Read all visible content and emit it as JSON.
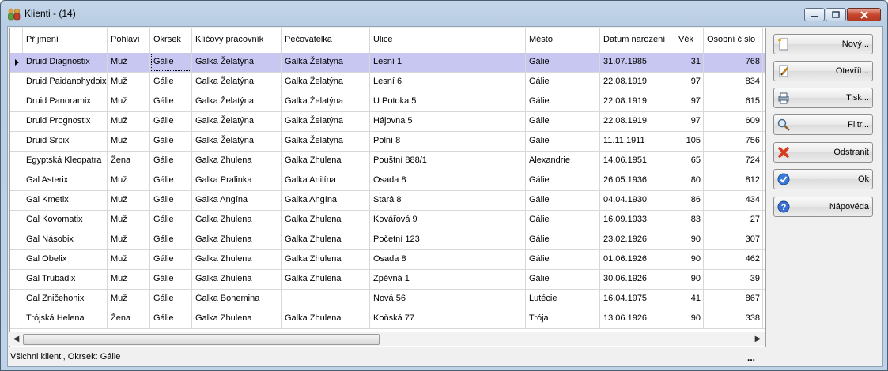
{
  "window": {
    "title": "Klienti - (14)"
  },
  "columns": [
    {
      "label": "Příjmení",
      "w": 107
    },
    {
      "label": "Pohlaví",
      "w": 54
    },
    {
      "label": "Okrsek",
      "w": 53
    },
    {
      "label": "Klíčový pracovník",
      "w": 113
    },
    {
      "label": "Pečovatelka",
      "w": 112
    },
    {
      "label": "Ulice",
      "w": 197
    },
    {
      "label": "Město",
      "w": 94
    },
    {
      "label": "Datum narození",
      "w": 95
    },
    {
      "label": "Věk",
      "w": 36
    },
    {
      "label": "Osobní číslo",
      "w": 75
    }
  ],
  "rows": [
    [
      "Druid Diagnostix",
      "Muž",
      "Gálie",
      "Galka Želatýna",
      "Galka Želatýna",
      "Lesní 1",
      "Gálie",
      "31.07.1985",
      "31",
      "768"
    ],
    [
      "Druid Paidanohydoix",
      "Muž",
      "Gálie",
      "Galka Želatýna",
      "Galka Želatýna",
      "Lesní 6",
      "Gálie",
      "22.08.1919",
      "97",
      "834"
    ],
    [
      "Druid Panoramix",
      "Muž",
      "Gálie",
      "Galka Želatýna",
      "Galka Želatýna",
      "U Potoka 5",
      "Gálie",
      "22.08.1919",
      "97",
      "615"
    ],
    [
      "Druid Prognostix",
      "Muž",
      "Gálie",
      "Galka Želatýna",
      "Galka Želatýna",
      "Hájovna 5",
      "Gálie",
      "22.08.1919",
      "97",
      "609"
    ],
    [
      "Druid Srpix",
      "Muž",
      "Gálie",
      "Galka Želatýna",
      "Galka Želatýna",
      "Polní 8",
      "Gálie",
      "11.11.1911",
      "105",
      "756"
    ],
    [
      "Egyptská Kleopatra",
      "Žena",
      "Gálie",
      "Galka Zhulena",
      "Galka Zhulena",
      "Pouštní 888/1",
      "Alexandrie",
      "14.06.1951",
      "65",
      "724"
    ],
    [
      "Gal Asterix",
      "Muž",
      "Gálie",
      "Galka Pralinka",
      "Galka Anilína",
      "Osada 8",
      "Gálie",
      "26.05.1936",
      "80",
      "812"
    ],
    [
      "Gal Kmetix",
      "Muž",
      "Gálie",
      "Galka Angína",
      "Galka Angína",
      "Stará 8",
      "Gálie",
      "04.04.1930",
      "86",
      "434"
    ],
    [
      "Gal Kovomatix",
      "Muž",
      "Gálie",
      "Galka Zhulena",
      "Galka Zhulena",
      "Kovářová 9",
      "Gálie",
      "16.09.1933",
      "83",
      "27"
    ],
    [
      "Gal Násobix",
      "Muž",
      "Gálie",
      "Galka Zhulena",
      "Galka Zhulena",
      "Početní 123",
      "Gálie",
      "23.02.1926",
      "90",
      "307"
    ],
    [
      "Gal Obelix",
      "Muž",
      "Gálie",
      "Galka Zhulena",
      "Galka Zhulena",
      "Osada 8",
      "Gálie",
      "01.06.1926",
      "90",
      "462"
    ],
    [
      "Gal Trubadix",
      "Muž",
      "Gálie",
      "Galka Zhulena",
      "Galka Zhulena",
      "Zpěvná 1",
      "Gálie",
      "30.06.1926",
      "90",
      "39"
    ],
    [
      "Gal Zničehonix",
      "Muž",
      "Gálie",
      "Galka Bonemina",
      "",
      "Nová 56",
      "Lutécie",
      "16.04.1975",
      "41",
      "867"
    ],
    [
      "Trójská Helena",
      "Žena",
      "Gálie",
      "Galka Zhulena",
      "Galka Zhulena",
      "Koňská 77",
      "Trója",
      "13.06.1926",
      "90",
      "338"
    ]
  ],
  "selected_row": 0,
  "buttons": [
    {
      "label": "Nový...",
      "icon": "new-document-icon"
    },
    {
      "label": "Otevřít...",
      "icon": "edit-document-icon"
    },
    {
      "label": "Tisk...",
      "icon": "print-icon"
    },
    {
      "label": "Filtr...",
      "icon": "magnifier-icon"
    },
    {
      "label": "Odstranit",
      "icon": "delete-x-icon"
    },
    {
      "label": "Ok",
      "icon": "checkmark-icon"
    },
    {
      "label": "Nápověda",
      "icon": "help-icon"
    }
  ],
  "status": {
    "text": "Všichni klienti, Okrsek: Gálie",
    "dots": "..."
  }
}
